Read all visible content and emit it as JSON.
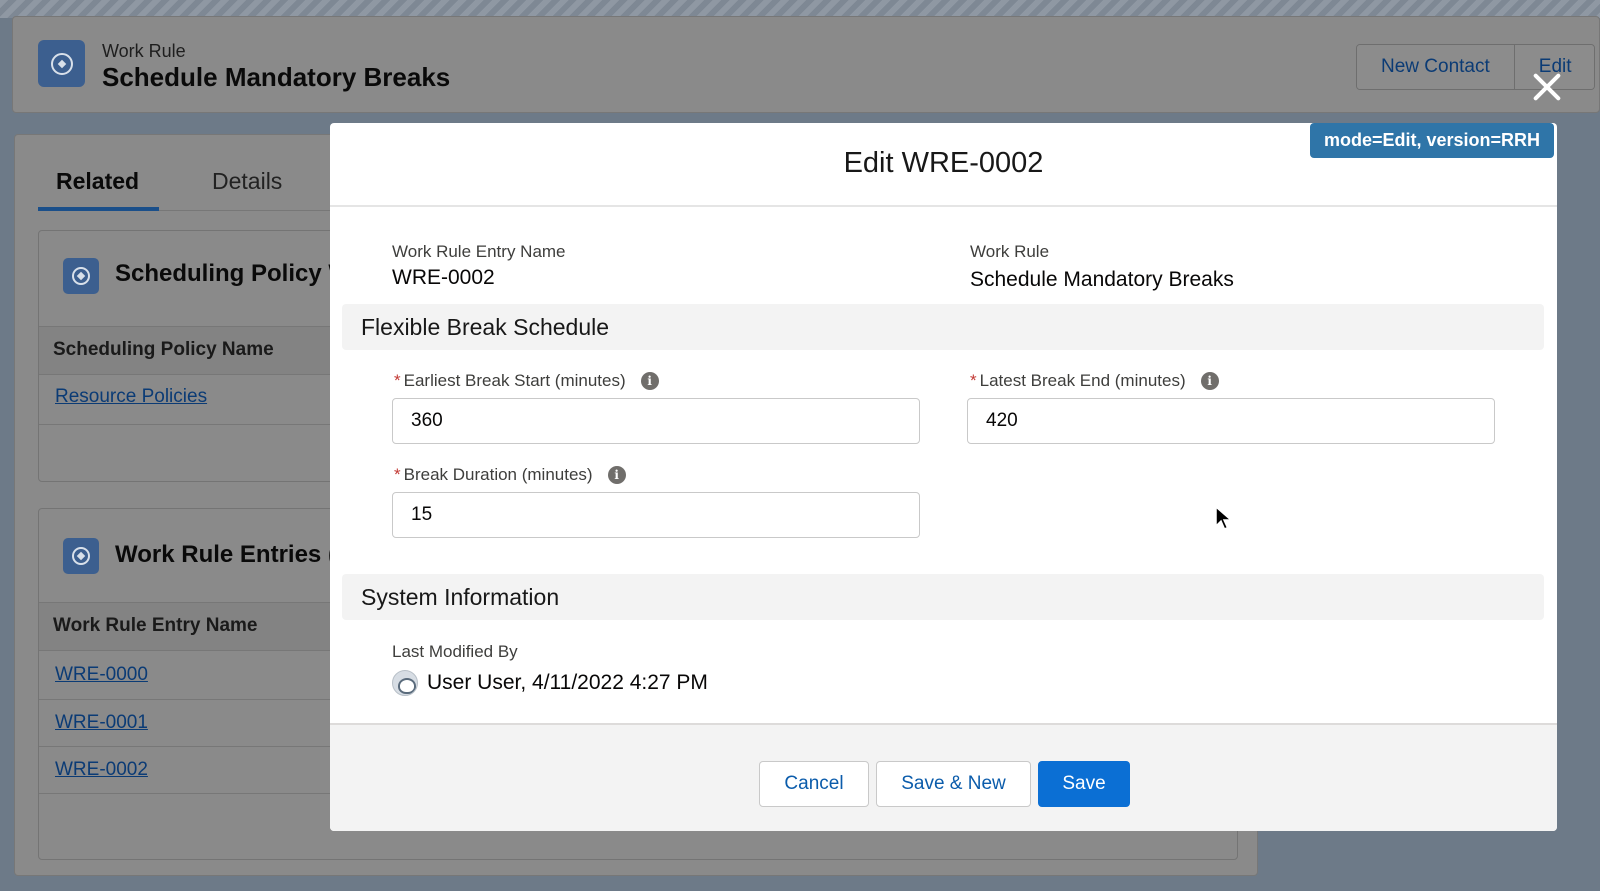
{
  "record_header": {
    "object_label": "Work Rule",
    "title": "Schedule Mandatory Breaks",
    "icon": "compass-icon",
    "actions": [
      "New Contact",
      "Edit"
    ]
  },
  "tabs": [
    {
      "label": "Related",
      "active": true
    },
    {
      "label": "Details",
      "active": false
    }
  ],
  "related_lists": {
    "scheduling_policy": {
      "title": "Scheduling Policy W",
      "column_header": "Scheduling Policy Name",
      "rows": [
        "Resource Policies"
      ]
    },
    "work_rule_entries": {
      "title": "Work Rule Entries (",
      "column_header": "Work Rule Entry Name",
      "rows": [
        "WRE-0000",
        "WRE-0001",
        "WRE-0002"
      ]
    }
  },
  "modal": {
    "badge": "mode=Edit, version=RRH",
    "title": "Edit WRE-0002",
    "info": {
      "entry_name_label": "Work Rule Entry Name",
      "entry_name_value": "WRE-0002",
      "work_rule_label": "Work Rule",
      "work_rule_value": "Schedule Mandatory Breaks"
    },
    "section_flexible": "Flexible Break Schedule",
    "fields": {
      "earliest_start": {
        "label": "Earliest Break Start (minutes)",
        "value": "360",
        "required": true
      },
      "latest_end": {
        "label": "Latest Break End (minutes)",
        "value": "420",
        "required": true
      },
      "duration": {
        "label": "Break Duration (minutes)",
        "value": "15",
        "required": true
      }
    },
    "required_marker": "*",
    "info_glyph": "i",
    "section_system": "System Information",
    "last_modified_label": "Last Modified By",
    "last_modified_value": "User User, 4/11/2022 4:27 PM",
    "buttons": {
      "cancel": "Cancel",
      "save_new": "Save & New",
      "save": "Save"
    }
  },
  "colors": {
    "brand": "#0b6fd4",
    "link": "#0b5cab",
    "badge": "#2f75a8",
    "required": "#c23934"
  }
}
